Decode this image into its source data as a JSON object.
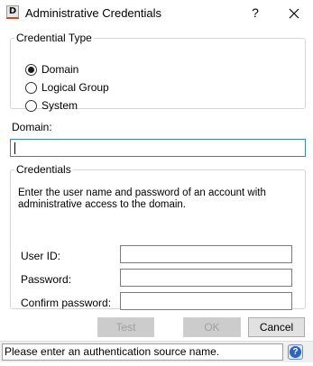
{
  "window": {
    "icon_letter": "D",
    "title": "Administrative Credentials",
    "help_label": "?"
  },
  "credential_type": {
    "legend": "Credential Type",
    "options": [
      {
        "label": "Domain",
        "selected": true
      },
      {
        "label": "Logical Group",
        "selected": false
      },
      {
        "label": "System",
        "selected": false
      }
    ]
  },
  "domain": {
    "label": "Domain:",
    "value": ""
  },
  "credentials": {
    "legend": "Credentials",
    "description": "Enter the user name and password of an account with administrative access to the domain.",
    "fields": {
      "user_id": {
        "label": "User ID:",
        "value": ""
      },
      "password": {
        "label": "Password:",
        "value": ""
      },
      "confirm_password": {
        "label": "Confirm password:",
        "value": ""
      }
    }
  },
  "buttons": {
    "test": "Test",
    "ok": "OK",
    "cancel": "Cancel"
  },
  "status": {
    "message": "Please enter an authentication source name."
  },
  "colors": {
    "focus_border": "#3b7fd4",
    "help_icon": "#2f63c2"
  }
}
